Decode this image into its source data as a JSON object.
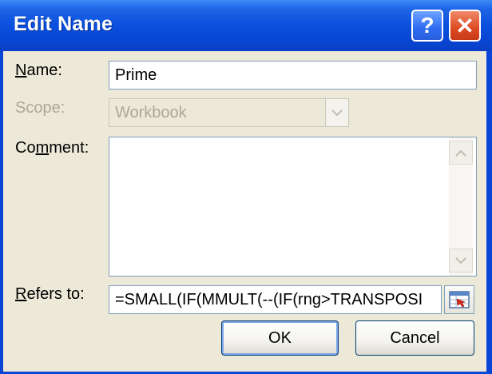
{
  "window": {
    "title": "Edit Name"
  },
  "title_buttons": {
    "help": "?",
    "close": "✕"
  },
  "name": {
    "label_mnemonic": "N",
    "label_rest": "ame:",
    "value": "Prime"
  },
  "scope": {
    "label": "Scope:",
    "value": "Workbook"
  },
  "comment": {
    "label_pre": "Co",
    "label_mnemonic": "m",
    "label_rest": "ment:",
    "value": ""
  },
  "refers_to": {
    "label_mnemonic": "R",
    "label_rest": "efers to:",
    "value": "=SMALL(IF(MMULT(--(IF(rng>TRANSPOSI"
  },
  "buttons": {
    "ok": "OK",
    "cancel": "Cancel"
  },
  "colors": {
    "title_bar": "#0a50de",
    "dialog_face": "#ece9d8",
    "close_button": "#dc4a22"
  }
}
